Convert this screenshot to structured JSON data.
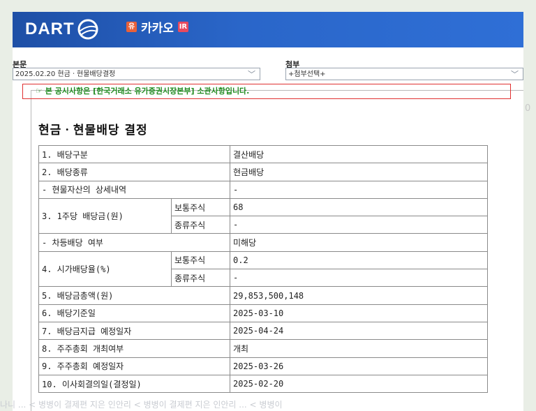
{
  "header": {
    "logo_text": "DART",
    "company_badge_yu": "유",
    "company_name": "카카오",
    "company_badge_ir": "IR"
  },
  "selectors": {
    "main_label": "본문",
    "main_value": "2025.02.20  현금ㆍ현물배당결정",
    "attach_label": "첨부",
    "attach_value": "+첨부선택+"
  },
  "notice": "☞ 본 공시사항은 [한국거래소 유가증권시장본부] 소관사항입니다.",
  "doc_title": "현금ㆍ현물배당 결정",
  "table": {
    "r1": {
      "label": "1. 배당구분",
      "value": "결산배당"
    },
    "r2": {
      "label": "2. 배당종류",
      "value": "현금배당"
    },
    "r3": {
      "label": "- 현물자산의 상세내역",
      "value": "-"
    },
    "r4": {
      "label": "3. 1주당 배당금(원)",
      "sub1": "보통주식",
      "val1": "68",
      "sub2": "종류주식",
      "val2": "-"
    },
    "r5": {
      "label": "- 차등배당 여부",
      "value": "미해당"
    },
    "r6": {
      "label": "4. 시가배당율(%)",
      "sub1": "보통주식",
      "val1": "0.2",
      "sub2": "종류주식",
      "val2": "-"
    },
    "r7": {
      "label": "5. 배당금총액(원)",
      "value": "29,853,500,148"
    },
    "r8": {
      "label": "6. 배당기준일",
      "value": "2025-03-10"
    },
    "r9": {
      "label": "7. 배당금지급 예정일자",
      "value": "2025-04-24"
    },
    "r10": {
      "label": "8. 주주총회 개최여부",
      "value": "개최"
    },
    "r11": {
      "label": "9. 주주총회 예정일자",
      "value": "2025-03-26"
    },
    "r12": {
      "label": "10. 이사회결의일(결정일)",
      "value": "2025-02-20"
    }
  },
  "side_text": "0",
  "watermark": "나니 ... < 병병이 결제편 지은 인안리 < 병병이 결제편 지은 인안리 ... < 병병이"
}
